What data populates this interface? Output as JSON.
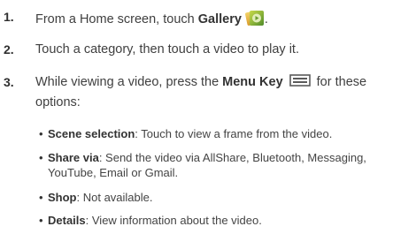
{
  "steps": [
    {
      "number": "1.",
      "text_before": "From a Home screen, touch ",
      "bold": "Gallery",
      "text_after": "."
    },
    {
      "number": "2.",
      "text": "Touch a category, then touch a video to play it."
    },
    {
      "number": "3.",
      "text_before": "While viewing a video, press the ",
      "bold": "Menu Key",
      "text_after": "for these",
      "line2": "options:"
    }
  ],
  "options": [
    {
      "label": "Scene selection",
      "desc": ": Touch to view a frame from the video."
    },
    {
      "label": "Share via",
      "desc": ": Send the video via AllShare, Bluetooth, Messaging,",
      "desc2": "YouTube, Email or Gmail."
    },
    {
      "label": "Shop",
      "desc": ": Not available."
    },
    {
      "label": "Details",
      "desc": ": View information about the video."
    }
  ],
  "bullet_glyph": "•",
  "icons": {
    "gallery": "gallery-app-icon",
    "menu_key": "menu-key-icon"
  }
}
